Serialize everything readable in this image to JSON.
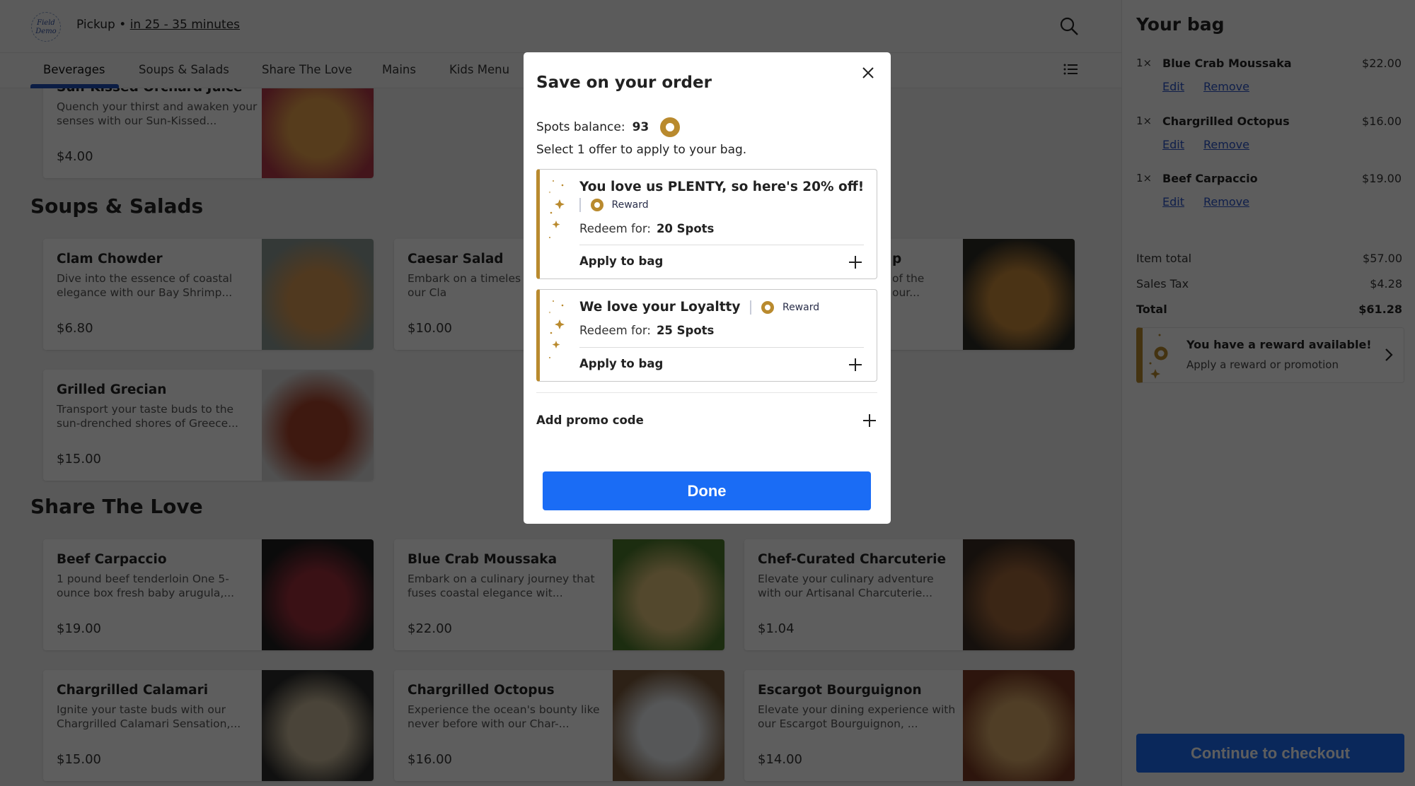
{
  "header": {
    "logo_text": "Field Demo",
    "pickup_label": "Pickup •",
    "pickup_time": "in 25 - 35 minutes",
    "search_icon": "search-icon"
  },
  "tabs": [
    {
      "label": "Beverages",
      "active": true
    },
    {
      "label": "Soups & Salads"
    },
    {
      "label": "Share The Love"
    },
    {
      "label": "Mains"
    },
    {
      "label": "Kids Menu"
    }
  ],
  "menu": {
    "sections": [
      "Soups & Salads",
      "Share The Love"
    ],
    "items": [
      {
        "name": "Sun-Kissed Orchard Juice",
        "desc": "Quench your thirst and awaken your senses with our Sun-Kissed...",
        "price": "$4.00",
        "image_colors": [
          "#e9a24c",
          "#b53a4a"
        ]
      },
      {
        "name": "Clam Chowder",
        "desc": "Dive into the essence of coastal elegance with our Bay Shrimp...",
        "price": "$6.80",
        "image_colors": [
          "#d99a54",
          "#8d9a94"
        ]
      },
      {
        "name": "Caesar Salad",
        "desc": "Embark on a timeles journey with our Cla",
        "price": "$10.00",
        "image_colors": [
          "#8aa86a",
          "#5a6e3e"
        ]
      },
      {
        "name": "p",
        "desc": "of the our...",
        "price": "",
        "image_colors": [
          "#c98a3a",
          "#2a2a24"
        ]
      },
      {
        "name": "Grilled Grecian",
        "desc": "Transport your taste buds to the sun-drenched shores of Greece...",
        "price": "$15.00",
        "image_colors": [
          "#a8442c",
          "#d8d8d8"
        ]
      },
      {
        "name": "Beef Carpaccio",
        "desc": "1 pound beef tenderloin One 5-ounce box fresh baby arugula,...",
        "price": "$19.00",
        "image_colors": [
          "#9c2e3a",
          "#1e1e1e"
        ]
      },
      {
        "name": "Blue Crab Moussaka",
        "desc": "Embark on a culinary journey that fuses coastal elegance wit...",
        "price": "$22.00",
        "image_colors": [
          "#e0c37a",
          "#4d7a2c"
        ]
      },
      {
        "name": "Chef-Curated Charcuterie",
        "desc": "Elevate your culinary adventure with our Artisanal Charcuterie...",
        "price": "$1.04",
        "image_colors": [
          "#a0663a",
          "#3a2c22"
        ]
      },
      {
        "name": "Chargrilled Calamari",
        "desc": "Ignite your taste buds with our Chargrilled Calamari Sensation,...",
        "price": "$15.00",
        "image_colors": [
          "#c9b99a",
          "#2a2a2a"
        ]
      },
      {
        "name": "Chargrilled Octopus",
        "desc": "Experience the ocean's bounty like never before with our Char-...",
        "price": "$16.00",
        "image_colors": [
          "#e8ecef",
          "#7a5a3c"
        ]
      },
      {
        "name": "Escargot Bourguignon",
        "desc": "Elevate your dining experience with our Escargot Bourguignon, ...",
        "price": "$14.00",
        "image_colors": [
          "#d8a868",
          "#7a3a22"
        ]
      }
    ]
  },
  "bag": {
    "title": "Your bag",
    "items": [
      {
        "qty": "1×",
        "name": "Blue Crab Moussaka",
        "price": "$22.00",
        "edit": "Edit",
        "remove": "Remove"
      },
      {
        "qty": "1×",
        "name": "Chargrilled Octopus",
        "price": "$16.00",
        "edit": "Edit",
        "remove": "Remove"
      },
      {
        "qty": "1×",
        "name": "Beef Carpaccio",
        "price": "$19.00",
        "edit": "Edit",
        "remove": "Remove"
      }
    ],
    "item_total_label": "Item total",
    "item_total": "$57.00",
    "tax_label": "Sales Tax",
    "tax": "$4.28",
    "total_label": "Total",
    "total": "$61.28",
    "reward_title": "You have a reward available!",
    "reward_sub": "Apply a reward or promotion",
    "checkout": "Continue to checkout"
  },
  "modal": {
    "title": "Save on your order",
    "balance_label": "Spots balance:",
    "balance": "93",
    "instruction": "Select 1 offer to apply to your bag.",
    "offers": [
      {
        "title": "You love us PLENTY, so here's 20% off!",
        "tag": "Reward",
        "redeem_label": "Redeem for:",
        "redeem": "20 Spots",
        "apply": "Apply to bag"
      },
      {
        "title": "We love your Loyaltty",
        "tag": "Reward",
        "redeem_label": "Redeem for:",
        "redeem": "25 Spots",
        "apply": "Apply to bag"
      }
    ],
    "promo": "Add promo code",
    "done": "Done"
  },
  "colors": {
    "accent_gold": "#b98a2e",
    "primary_blue": "#1a6cf5",
    "link_blue": "#2a55c9"
  }
}
